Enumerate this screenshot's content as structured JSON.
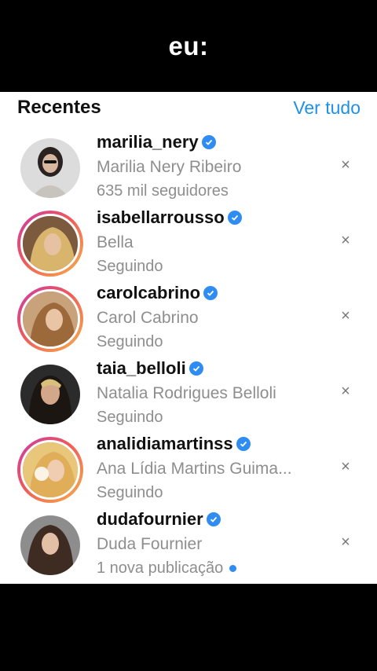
{
  "caption": "eu:",
  "header": {
    "title": "Recentes",
    "see_all": "Ver tudo"
  },
  "rows": [
    {
      "username": "marilia_nery",
      "full_name": "Marilia Nery Ribeiro",
      "status": "635 mil seguidores",
      "has_story": false,
      "new_dot": false
    },
    {
      "username": "isabellarrousso",
      "full_name": "Bella",
      "status": "Seguindo",
      "has_story": true,
      "new_dot": false
    },
    {
      "username": "carolcabrino",
      "full_name": "Carol Cabrino",
      "status": "Seguindo",
      "has_story": true,
      "new_dot": false
    },
    {
      "username": "taia_belloli",
      "full_name": "Natalia Rodrigues Belloli",
      "status": "Seguindo",
      "has_story": false,
      "new_dot": false
    },
    {
      "username": "analidiamartinss",
      "full_name": "Ana Lídia Martins Guima...",
      "status": "Seguindo",
      "has_story": true,
      "new_dot": false
    },
    {
      "username": "dudafournier",
      "full_name": "Duda Fournier",
      "status": "1 nova publicação",
      "has_story": false,
      "new_dot": true
    }
  ],
  "close_glyph": "×",
  "colors": {
    "accent": "#1e90e6",
    "verified": "#2f8cf0",
    "muted": "#8e8e8e"
  }
}
